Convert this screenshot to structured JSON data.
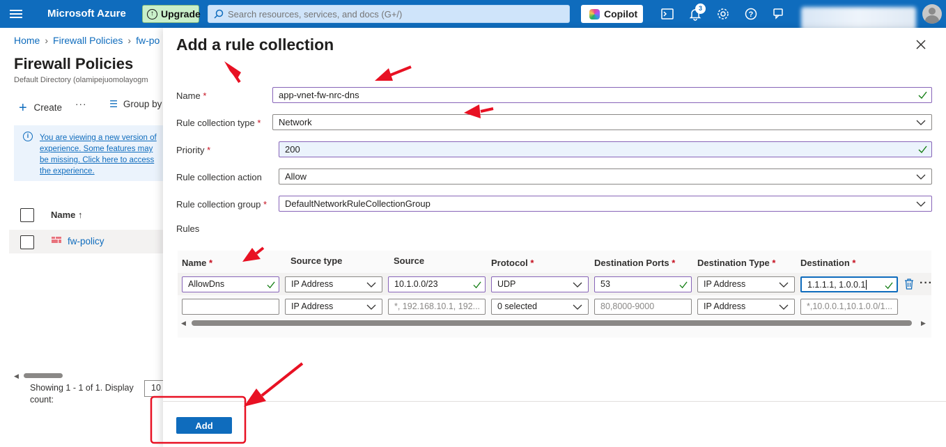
{
  "topbar": {
    "brand": "Microsoft Azure",
    "upgrade_label": "Upgrade",
    "search_placeholder": "Search resources, services, and docs (G+/)",
    "copilot_label": "Copilot",
    "notifications_count": "3"
  },
  "breadcrumb": {
    "items": [
      "Home",
      "Firewall Policies",
      "fw-po"
    ]
  },
  "page": {
    "title": "Firewall Policies",
    "subtitle": "Default Directory (olamipejuomolayogm",
    "create_label": "Create",
    "more_label": "···",
    "groupby_label": "Group by"
  },
  "info": {
    "text": "You are viewing a new version of experience. Some features may be missing. Click here to access the experience."
  },
  "list": {
    "header_name": "Name ↑",
    "rows": [
      {
        "name": "fw-policy"
      }
    ],
    "showing_text": "Showing 1 - 1 of 1. Display count:",
    "display_count": "10"
  },
  "panel": {
    "title": "Add a rule collection",
    "fields": {
      "name_label": "Name",
      "name_value": "app-vnet-fw-nrc-dns",
      "type_label": "Rule collection type",
      "type_value": "Network",
      "priority_label": "Priority",
      "priority_value": "200",
      "action_label": "Rule collection action",
      "action_value": "Allow",
      "group_label": "Rule collection group",
      "group_value": "DefaultNetworkRuleCollectionGroup"
    },
    "rules_label": "Rules",
    "required_mark": "*",
    "columns": [
      "Name",
      "Source type",
      "Source",
      "Protocol",
      "Destination Ports",
      "Destination Type",
      "Destination"
    ],
    "rows": [
      {
        "name": "AllowDns",
        "source_type": "IP Address",
        "source": "10.1.0.0/23",
        "protocol": "UDP",
        "ports": "53",
        "dest_type": "IP Address",
        "destination": "1.1.1.1, 1.0.0.1"
      },
      {
        "name": "",
        "source_type": "IP Address",
        "source_placeholder": "*, 192.168.10.1, 192...",
        "protocol": "0 selected",
        "ports_placeholder": "80,8000-9000",
        "dest_type": "IP Address",
        "destination_placeholder": "*,10.0.0.1,10.1.0.0/1..."
      }
    ],
    "add_label": "Add"
  },
  "colors": {
    "azure_blue": "#0f6cbd",
    "valid_border": "#8764b8",
    "check_green": "#107c10",
    "annotation_red": "#e81123"
  }
}
